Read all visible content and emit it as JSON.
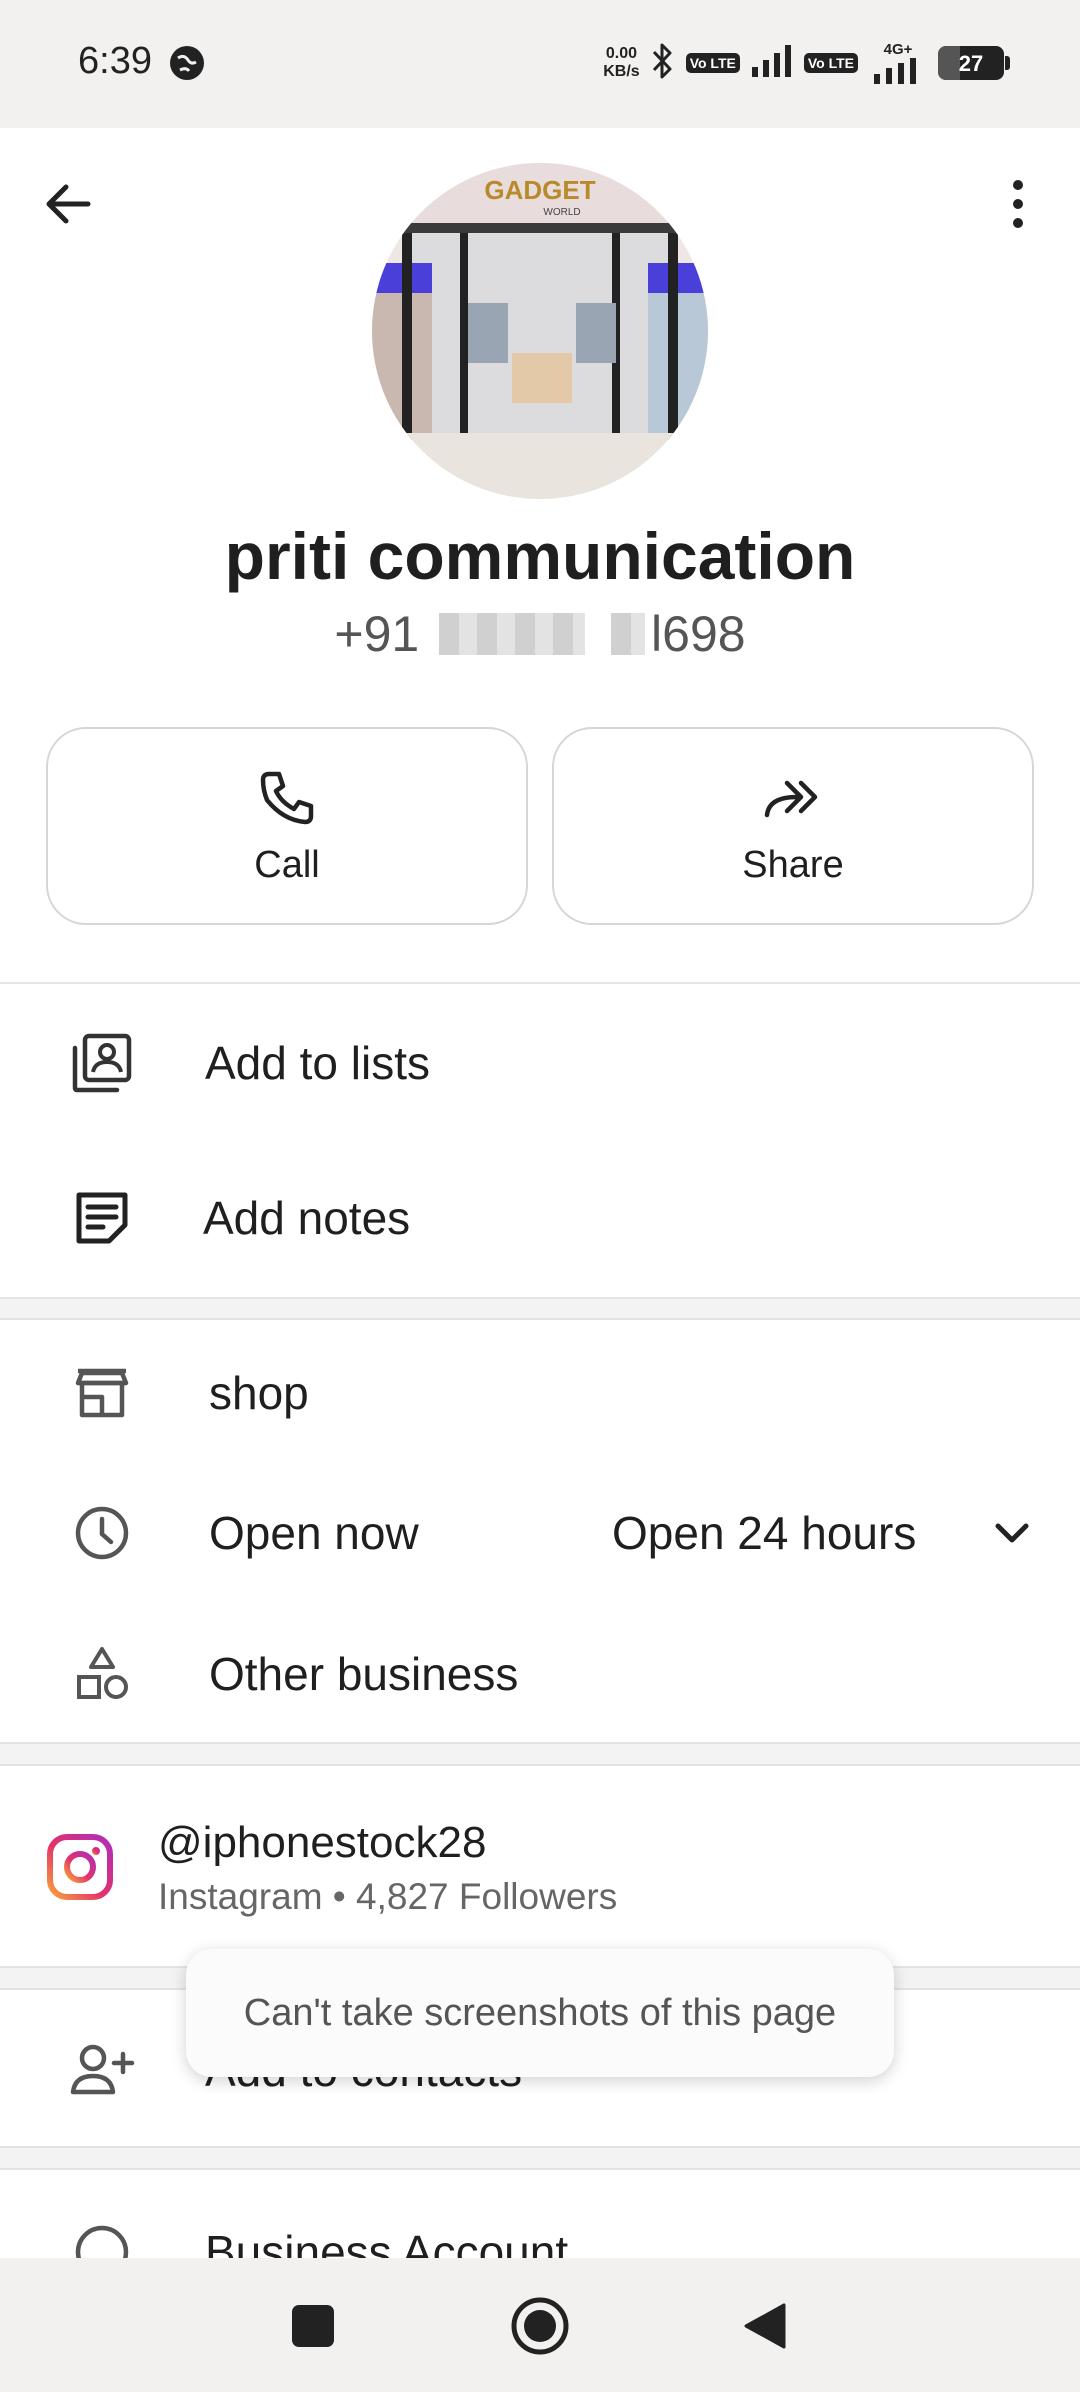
{
  "status_bar": {
    "time": "6:39",
    "net_speed_value": "0.00",
    "net_speed_unit": "KB/s",
    "volte_badge_1": "Vo LTE",
    "volte_badge_2": "Vo LTE",
    "network_type": "4G+",
    "battery_level": "27"
  },
  "contact": {
    "name": "priti communication",
    "phone_prefix": "+91",
    "phone_suffix": "l698",
    "avatar_sign_text": "GADGET",
    "avatar_sign_subtext": "WORLD"
  },
  "actions": {
    "call_label": "Call",
    "share_label": "Share"
  },
  "list_actions": {
    "add_to_lists": "Add to lists",
    "add_notes": "Add notes"
  },
  "business": {
    "category": "shop",
    "open_status": "Open now",
    "hours": "Open 24 hours",
    "other_business": "Other business",
    "open_status_color": "#1e9e52"
  },
  "instagram": {
    "handle": "@iphonestock28",
    "meta": "Instagram • 4,827 Followers"
  },
  "contacts_row": {
    "label": "Add to contacts"
  },
  "business_account": {
    "label": "Business Account"
  },
  "toast": {
    "message": "Can't take screenshots of this page"
  },
  "icons": {
    "back": "arrow-left-icon",
    "more": "more-vert-icon",
    "call": "phone-icon",
    "share": "share-forward-icon",
    "lists": "contact-list-icon",
    "notes": "note-icon",
    "shop": "storefront-icon",
    "clock": "clock-icon",
    "category": "shapes-icon",
    "instagram": "instagram-icon",
    "add_contact": "person-add-icon",
    "expand": "chevron-down-icon"
  }
}
